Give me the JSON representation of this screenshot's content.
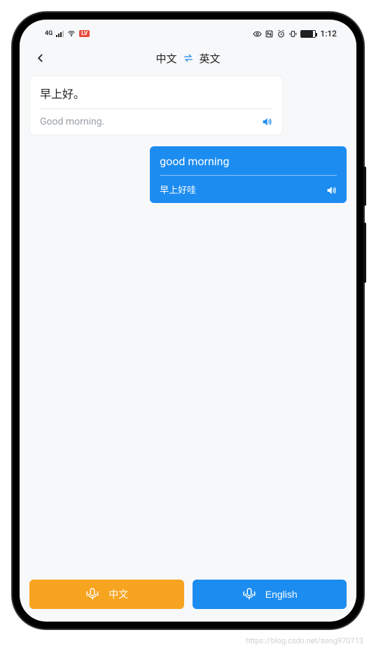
{
  "status": {
    "network": "4G",
    "rec_badge": "LV",
    "time": "1:12"
  },
  "header": {
    "lang_from": "中文",
    "lang_to": "英文"
  },
  "messages": [
    {
      "side": "left",
      "source": "早上好。",
      "target": "Good morning.",
      "sound_color": "#1c8cf0"
    },
    {
      "side": "right",
      "source": "good morning",
      "target": "早上好哇",
      "sound_color": "#ffffff"
    }
  ],
  "footer": {
    "left_label": "中文",
    "right_label": "English"
  },
  "watermark": "https://blog.csdn.net/song970713"
}
